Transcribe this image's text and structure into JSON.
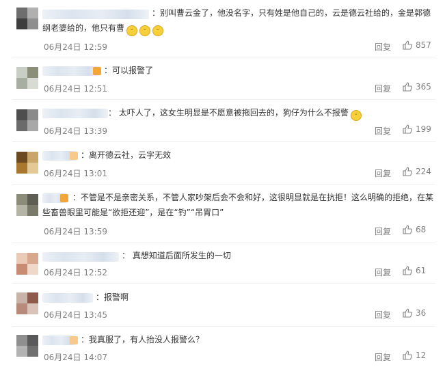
{
  "colors": {
    "text": "#333333",
    "meta": "#808080",
    "divider": "#eeeeee"
  },
  "comments": [
    {
      "text_line1": "：别叫曹云金了，他没名字，只有姓是他自己的，云是德云社给的，金是郭德",
      "text_line2": "纲老婆给的，他只有曹",
      "emoji_icon": "shy-face-emoji",
      "date": "06月24日",
      "time": "12:59",
      "reply_label": "回复",
      "likes": "857",
      "avatar_colors": [
        "#6e6e6e",
        "#b0b0b0",
        "#3e3e3e",
        "#8f8f8f"
      ]
    },
    {
      "text_line1": "：可以报警了",
      "date": "06月24日",
      "time": "12:51",
      "reply_label": "回复",
      "likes": "365",
      "avatar_colors": [
        "#c9cfc4",
        "#8b8f7a",
        "#a9aea3",
        "#d8dbd1"
      ]
    },
    {
      "text_line1": "： 太吓人了，这女生明显是不愿意被拖回去的，狗仔为什么不报警",
      "emoji_icon": "smile-face-emoji",
      "date": "06月24日",
      "time": "13:39",
      "reply_label": "回复",
      "likes": "199",
      "avatar_colors": [
        "#4e4e4e",
        "#8a8a8a",
        "#6b6b6b",
        "#a8a8a8"
      ]
    },
    {
      "text_line1": "：离开德云社，云字无效",
      "date": "06月24日",
      "time": "13:01",
      "reply_label": "回复",
      "likes": "224",
      "avatar_colors": [
        "#6a4a1e",
        "#c9a56a",
        "#a8782e",
        "#e3c996"
      ]
    },
    {
      "text_line1": "：不管是不是亲密关系，不管人家吵架后会不会和好，这很明显就是在抗拒！这么明确的拒绝，在某",
      "text_line2": "些畜兽眼里可能是“欲拒还迎”，是在“钓”“吊胃口”",
      "date": "06月24日",
      "time": "13:59",
      "reply_label": "回复",
      "likes": "68",
      "avatar_colors": [
        "#8c8c7a",
        "#5e5e52",
        "#b5b5a5",
        "#7a7a6a"
      ]
    },
    {
      "text_line1": "： 真想知道后面所发生的一切",
      "date": "06月24日",
      "time": "12:52",
      "reply_label": "回复",
      "likes": "61",
      "avatar_colors": [
        "#e9cbb8",
        "#d9a78e",
        "#c88c72",
        "#efd8c8"
      ]
    },
    {
      "text_line1": "：报警啊",
      "date": "06月24日",
      "time": "13:45",
      "reply_label": "回复",
      "likes": "36",
      "avatar_colors": [
        "#c9b3a8",
        "#8e5a4c",
        "#b88a7a",
        "#d9c3b8"
      ]
    },
    {
      "text_line1": "：我真服了，有人抬没人报警么？",
      "date": "06月24日",
      "time": "14:07",
      "reply_label": "回复",
      "likes": "12",
      "avatar_colors": [
        "#8f8f8f",
        "#5a5a5a",
        "#b3b3b3",
        "#707070"
      ]
    }
  ]
}
